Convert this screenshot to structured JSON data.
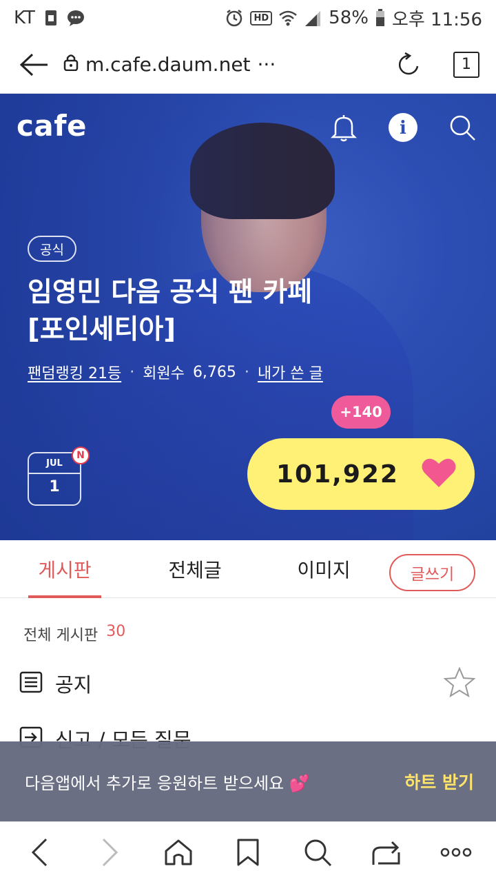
{
  "status_bar": {
    "carrier": "KT",
    "hd_label": "HD",
    "battery": "58%",
    "time": "오후 11:56"
  },
  "browser": {
    "url": "m.cafe.daum.net",
    "more": "···",
    "tab_count": "1"
  },
  "hero": {
    "logo": "cafe",
    "official_badge": "공식",
    "title": "임영민 다음 공식 팬 카페 [포인세티아]",
    "ranking": "팬덤랭킹 21등",
    "members_label": "회원수",
    "members_count": "6,765",
    "my_posts": "내가 쓴 글",
    "heart_delta": "+140",
    "heart_count": "101,922",
    "calendar": {
      "month": "JUL",
      "day": "1",
      "new_badge": "N"
    }
  },
  "tabs": [
    {
      "label": "게시판",
      "active": true
    },
    {
      "label": "전체글",
      "active": false
    },
    {
      "label": "이미지",
      "active": false
    }
  ],
  "write_button": "글쓰기",
  "board": {
    "header_label": "전체 게시판",
    "header_count": "30",
    "items": [
      {
        "label": "공지",
        "icon": "list-icon"
      },
      {
        "label": "신고 / 모든 질문",
        "icon": "export-icon"
      }
    ]
  },
  "promo": {
    "text": "다음앱에서 추가로 응원하트 받으세요 💕",
    "action": "하트 받기"
  },
  "colors": {
    "accent": "#e05a5a",
    "hero_blue": "#2d4fb5",
    "heart_pill": "#fff176",
    "heart_pink": "#ef5a9b",
    "promo_bg": "#666a80",
    "promo_action": "#ffe46b"
  }
}
